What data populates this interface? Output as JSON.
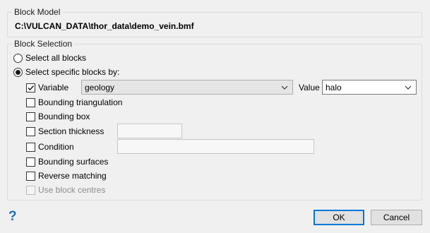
{
  "block_model": {
    "title": "Block Model",
    "path": "C:\\VULCAN_DATA\\thor_data\\demo_vein.bmf"
  },
  "block_selection": {
    "title": "Block Selection",
    "radio_all": "Select all blocks",
    "radio_specific": "Select specific blocks by:",
    "variable": {
      "label": "Variable",
      "checked": true,
      "value": "geology"
    },
    "value_label": "Value",
    "value_value": "halo",
    "options": {
      "bounding_triangulation": "Bounding triangulation",
      "bounding_box": "Bounding box",
      "section_thickness": "Section thickness",
      "condition": "Condition",
      "bounding_surfaces": "Bounding surfaces",
      "reverse_matching": "Reverse matching",
      "use_block_centres": "Use block centres"
    }
  },
  "footer": {
    "help_icon": "?",
    "ok": "OK",
    "cancel": "Cancel"
  },
  "colors": {
    "help": "#1f6fbd",
    "accent": "#0078d7"
  }
}
